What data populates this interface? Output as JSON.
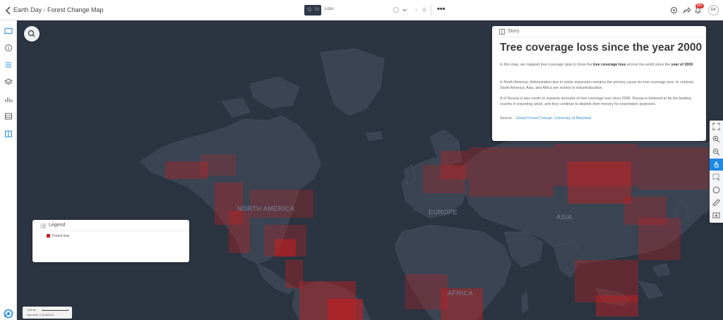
{
  "header": {
    "title": "Earth Day - Forest Change Map",
    "layer_name": "Loss",
    "notification_count": "99+",
    "user_initials": "EK"
  },
  "map": {
    "labels": {
      "north_america": "NORTH AMERICA",
      "europe": "EUROPE",
      "asia": "ASIA",
      "africa": "AFRICA"
    }
  },
  "story": {
    "label": "Story",
    "title": "Tree coverage loss since the year 2000",
    "p1_a": "In this map, we mapped tree coverage data to show the ",
    "p1_b": "tree coverage loss",
    "p1_c": " across the world since the ",
    "p1_d": "year of 2000",
    "p1_e": ".",
    "p2": "In North America, deforestation due to urban expansion remains the primary cause for tree coverage loss. In contrast, South America, Asia, and Africa are victims to industrialization.",
    "p3": "A of Russia is also victim to massive amounts of tree coverage loss since 2000. Russia is believed to be the leading country in exporting wood, and they continue to deplete their forestry for exportation purposes.",
    "source_label": "Source:",
    "source_link": "Global Forest Change, University of Maryland"
  },
  "legend": {
    "title": "Legend",
    "items": [
      {
        "label": "Forest loss",
        "color": "#c81e1e"
      }
    ]
  },
  "scale": {
    "distance": "1000 km",
    "map_scale": "Map scale: 1:55,468,024"
  },
  "colors": {
    "accent": "#1e88e5",
    "loss": "#c81e1e",
    "ocean": "#2b3441",
    "land": "#3b4554"
  }
}
